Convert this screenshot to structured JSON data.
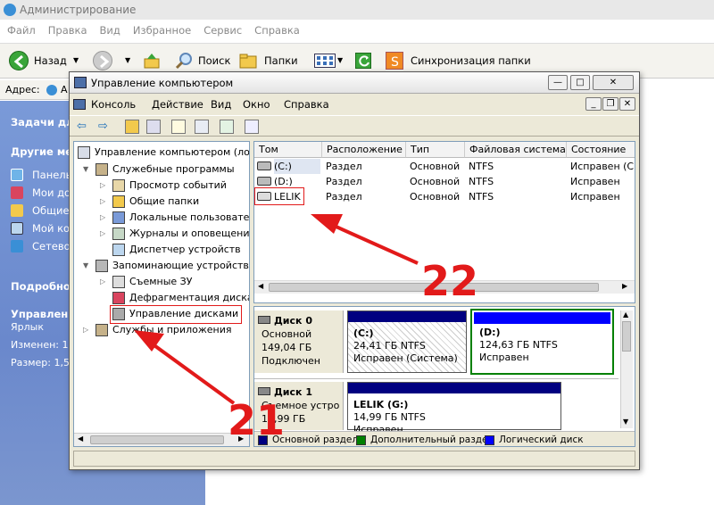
{
  "explorer": {
    "title": "Администрирование",
    "menu": [
      "Файл",
      "Правка",
      "Вид",
      "Избранное",
      "Сервис",
      "Справка"
    ],
    "toolbar": {
      "back_label": "Назад",
      "search_label": "Поиск",
      "folders_label": "Папки",
      "sync_label": "Синхронизация папки"
    },
    "address_label": "Адрес:",
    "address_value": "А",
    "left_panel": {
      "tasks_title": "Задачи для",
      "other_title": "Другие мес",
      "other_items": [
        "Панель",
        "Мои до",
        "Общие",
        "Мой ко",
        "Сетевое"
      ],
      "details_title": "Подробно",
      "details_name": "Управлени",
      "details_type": "Ярлык",
      "details_modified": "Изменен: 1",
      "details_size": "Размер: 1,5"
    }
  },
  "mmc": {
    "title": "Управление компьютером",
    "menu": [
      "Консоль",
      "Действие",
      "Вид",
      "Окно",
      "Справка"
    ],
    "tree": {
      "root": "Управление компьютером (лок",
      "groups": [
        {
          "label": "Служебные программы",
          "items": [
            "Просмотр событий",
            "Общие папки",
            "Локальные пользовател",
            "Журналы и оповещения",
            "Диспетчер устройств"
          ]
        },
        {
          "label": "Запоминающие устройства",
          "items": [
            "Съемные ЗУ",
            "Дефрагментация диска",
            "Управление дисками"
          ]
        },
        {
          "label": "Службы и приложения",
          "items": []
        }
      ]
    },
    "list": {
      "columns": [
        "Том",
        "Расположение",
        "Тип",
        "Файловая система",
        "Состояние"
      ],
      "rows": [
        [
          "(C:)",
          "Раздел",
          "Основной",
          "NTFS",
          "Исправен (С"
        ],
        [
          "(D:)",
          "Раздел",
          "Основной",
          "NTFS",
          "Исправен"
        ],
        [
          "LELIK",
          "Раздел",
          "Основной",
          "NTFS",
          "Исправен"
        ]
      ]
    },
    "disks": [
      {
        "name": "Диск 0",
        "type": "Основной",
        "size": "149,04 ГБ",
        "status": "Подключен",
        "partitions": [
          {
            "name": "(C:)",
            "size": "24,41 ГБ NTFS",
            "status": "Исправен (Система)"
          },
          {
            "name": "(D:)",
            "size": "124,63 ГБ NTFS",
            "status": "Исправен"
          }
        ]
      },
      {
        "name": "Диск 1",
        "type": "Съемное устро",
        "size": "14,99 ГБ",
        "status": "",
        "partitions": [
          {
            "name": "LELIK  (G:)",
            "size": "14,99 ГБ NTFS",
            "status": "Исправен"
          }
        ]
      }
    ],
    "legend": [
      {
        "label": "Основной раздел",
        "color": "#000080"
      },
      {
        "label": "Дополнительный раздел",
        "color": "#008000"
      },
      {
        "label": "Логический диск",
        "color": "#0000ff"
      }
    ]
  },
  "annotations": {
    "tree_step": "21",
    "list_step": "22",
    "color": "#e21a1a"
  }
}
